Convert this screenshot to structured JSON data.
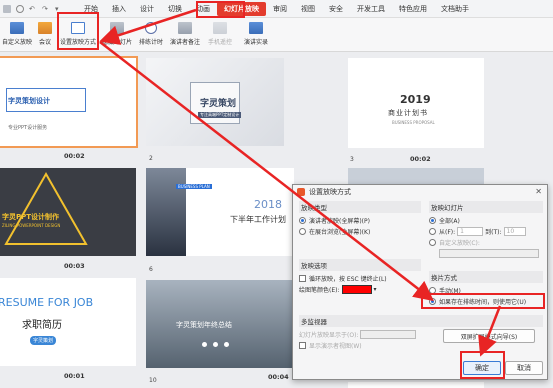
{
  "menubar": {
    "tabs": [
      "开始",
      "插入",
      "设计",
      "切换",
      "动画",
      "幻灯片放映",
      "审阅",
      "视图",
      "安全",
      "开发工具",
      "特色应用",
      "文档助手"
    ],
    "active_tab": "幻灯片放映"
  },
  "ribbon": {
    "buttons": [
      "自定义放映",
      "会议",
      "设置放映方式",
      "隐藏幻灯片",
      "排练计时",
      "演讲者备注",
      "手机遥控",
      "演讲实录"
    ]
  },
  "slides": [
    {
      "num": "",
      "time": "00:02",
      "title": "字灵策划设计",
      "subtitle": "专业PPT设计服务"
    },
    {
      "num": "2",
      "time": "",
      "title": "字灵策划",
      "subtitle": "专注高端PPT定制设计"
    },
    {
      "num": "3",
      "time": "00:02",
      "title": "2019",
      "subtitle": "商业计划书",
      "caption": "BUSINESS PROPOSAL"
    },
    {
      "num": "",
      "time": "00:03",
      "title": "字灵PPT设计制作",
      "subtitle": "ZILING POWERPOINT DESIGN"
    },
    {
      "num": "6",
      "time": "",
      "title": "2018",
      "subtitle": "下半年工作计划",
      "caption": "BUSINESS PLAN"
    },
    {
      "num": "",
      "time": "00:01",
      "title": "RESUME FOR JOB",
      "subtitle": "求职简历",
      "caption": "字灵策划"
    },
    {
      "num": "10",
      "time": "00:04",
      "title": "字灵策划年终总结"
    }
  ],
  "dialog": {
    "title": "设置放映方式",
    "close": "✕",
    "show_type": {
      "label": "放映类型",
      "options": [
        "演讲者放映(全屏幕)(P)",
        "在展台浏览(全屏幕)(K)"
      ]
    },
    "slides_range": {
      "label": "放映幻灯片",
      "all": "全部(A)",
      "from": "从(F):",
      "from_value": "1",
      "to": "到(T):",
      "to_value": "10",
      "custom": "自定义放映(C):"
    },
    "show_options": {
      "label": "放映选项",
      "loop": "循环放映，按 ESC 键终止(L)",
      "pen_color": "绘图笔颜色(E):",
      "pen_color_value": "#ff0000"
    },
    "advance": {
      "label": "换片方式",
      "manual": "手动(M)",
      "timings": "如果存在排练时间，则使用它(U)"
    },
    "multi_monitor": {
      "label": "多监视器",
      "display_on": "幻灯片放映显示于(O):",
      "presenter_view": "显示演示者视图(W)",
      "dual_screen": "双屏扩展模式向导(S)"
    },
    "ok": "确定",
    "cancel": "取消"
  },
  "colors": {
    "accent": "#e33c2d",
    "highlight": "#e82424",
    "selection": "#f29a54"
  }
}
